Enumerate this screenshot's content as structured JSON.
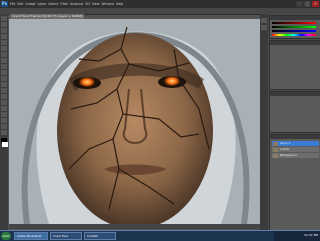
{
  "app": {
    "logo": "Ps"
  },
  "menu": [
    "File",
    "Edit",
    "Image",
    "Layer",
    "Select",
    "Filter",
    "Analysis",
    "3D",
    "View",
    "Window",
    "Help"
  ],
  "document": {
    "tab_title": "Crack Face Final.psd @ 66.7% (Layer 1, RGB/8)"
  },
  "layers": [
    {
      "label": "Layer 1"
    },
    {
      "label": "cracks"
    },
    {
      "label": "Background"
    }
  ],
  "taskbar": {
    "start_label": "start",
    "tasks": [
      {
        "label": "Adobe Photoshop"
      },
      {
        "label": "Crack Face"
      },
      {
        "label": "Untitled"
      }
    ],
    "clock": "12:47 PM"
  },
  "colors": {
    "selected_layer": "#3a7bd5",
    "taskbar": "#1d3450",
    "eye_glow": "#ff7a1a"
  }
}
